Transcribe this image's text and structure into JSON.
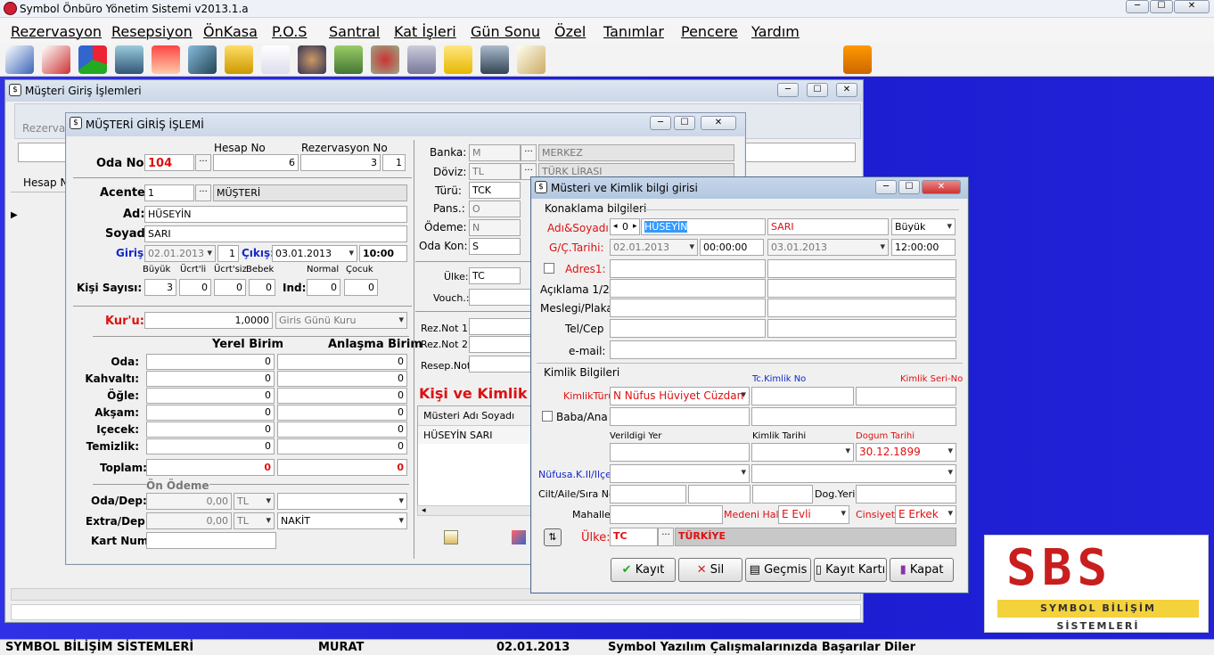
{
  "app": {
    "title": "Symbol Önbüro Yönetim Sistemi v2013.1.a",
    "min": "─",
    "max": "☐",
    "close": "✕"
  },
  "menu": [
    "Rezervasyon",
    "Resepsiyon",
    "ÖnKasa",
    "P.O.S",
    "Santral",
    "Kat İşleri",
    "Gün Sonu",
    "Özel",
    "Tanımlar",
    "Pencere",
    "Yardım"
  ],
  "toolbar_icons": [
    "edit-icon",
    "checklist-icon",
    "pie-chart-icon",
    "monitor-icon",
    "home-icon",
    "satellite-icon",
    "folder-icon",
    "document-icon",
    "user-search-icon",
    "money-icon",
    "disc-icon",
    "calculator-icon",
    "notes-icon",
    "presenter-icon",
    "notepad-icon",
    "exit-door-icon"
  ],
  "outer": {
    "title": "Müşteri Giriş İşlemleri",
    "rezervasyon": "Rezervas",
    "hesap": "Hesap N"
  },
  "mgi": {
    "title": "MÜŞTERİ GİRİŞ İŞLEMİ",
    "hesap_no_label": "Hesap No",
    "rez_no_label": "Rezervasyon No",
    "oda_no_label": "Oda No:",
    "oda_no": "104",
    "hesap_no": "6",
    "rez_no": "3",
    "rez_seq": "1",
    "acente_label": "Acente:",
    "acente": "1",
    "acente_name": "MÜŞTERİ",
    "ad_label": "Ad:",
    "ad": "HÜSEYİN",
    "soyad_label": "Soyad:",
    "soyad": "SARI",
    "giris_label": "Giriş:",
    "giris": "02.01.2013",
    "gece": "1",
    "cikis_label": "Çıkış:",
    "cikis": "03.01.2013",
    "saat": "10:00",
    "buyuk": "Büyük",
    "ucretli": "Ücrt'li",
    "ucretsiz": "Ücrt'siz",
    "bebek": "Bebek",
    "normal": "Normal",
    "cocuk": "Çocuk",
    "kisi_label": "Kişi Sayısı:",
    "k1": "3",
    "k2": "0",
    "k3": "0",
    "k4": "0",
    "ind_label": "Ind:",
    "k5": "0",
    "k6": "0",
    "kur_label": "Kur'u:",
    "kur": "1,0000",
    "kur_tipi": "Giris Günü Kuru",
    "yerel": "Yerel Birim",
    "anlasma": "Anlaşma Birim",
    "meals": [
      {
        "label": "Oda:",
        "y": "0",
        "a": "0"
      },
      {
        "label": "Kahvaltı:",
        "y": "0",
        "a": "0"
      },
      {
        "label": "Öğle:",
        "y": "0",
        "a": "0"
      },
      {
        "label": "Akşam:",
        "y": "0",
        "a": "0"
      },
      {
        "label": "Içecek:",
        "y": "0",
        "a": "0"
      },
      {
        "label": "Temizlik:",
        "y": "0",
        "a": "0"
      }
    ],
    "toplam_label": "Toplam:",
    "toplam_y": "0",
    "toplam_a": "0",
    "on_odeme": "Ön Ödeme",
    "oda_dep_label": "Oda/Dep:",
    "oda_dep": "0,00",
    "oda_dep_cur": "TL",
    "extra_dep_label": "Extra/Dep:",
    "extra_dep": "0,00",
    "extra_dep_cur": "TL",
    "odeme_tipi": "NAKİT",
    "kart_label": "Kart Num:",
    "banka_label": "Banka:",
    "banka": "M",
    "banka_name": "MERKEZ",
    "doviz_label": "Döviz:",
    "doviz": "TL",
    "doviz_name": "TÜRK LİRASI",
    "turu_label": "Türü:",
    "turu": "TCK",
    "pans_label": "Pans.:",
    "pans": "O",
    "odeme_label": "Ödeme:",
    "odeme": "N",
    "odakon_label": "Oda Kon:",
    "odakon": "S",
    "ulke_label": "Ülke:",
    "ulke": "TC",
    "vouch_label": "Vouch.:",
    "reznot1": "Rez.Not 1:",
    "reznot2": "Rez.Not 2:",
    "resepnot": "Resep.Not:",
    "kisi_kimlik": "Kişi ve Kimlik Bi",
    "col_header": "Müsteri Adı Soyadı",
    "guest_row": "HÜSEYİN SARI"
  },
  "mk": {
    "title": "Müsteri ve Kimlik bilgi girisi",
    "konaklama": "Konaklama bilgileri",
    "adsoyad_label": "Adı&Soyadı",
    "seq": "0",
    "ad": "HÜSEYİN",
    "soyad": "SARI",
    "tip": "Büyük",
    "gc_label": "G/Ç.Tarihi:",
    "giris": "02.01.2013",
    "giris_saat": "00:00:00",
    "cikis": "03.01.2013",
    "cikis_saat": "12:00:00",
    "adres_label": "Adres1:",
    "aciklama_label": "Açıklama 1/2:",
    "meslek_label": "Meslegi/Plaka",
    "tel_label": "Tel/Cep",
    "email_label": "e-mail:",
    "kimlik_bilgileri": "Kimlik Bilgileri",
    "tc_label": "Tc.Kimlik No",
    "seri_label": "Kimlik Seri-No",
    "kimlik_turu_label": "KimlikTürü:",
    "kimlik_turu": "N Nüfus Hüviyet Cüzdan",
    "baba_label": "Baba/Ana",
    "verildigi_label": "Verildigi Yer",
    "kimlik_tarihi_label": "Kimlik Tarihi",
    "dogum_label": "Dogum Tarihi",
    "dogum": "30.12.1899",
    "nufus_label": "Nüfusa.K.Il/Ilçe:",
    "cilt_label": "Cilt/Aile/Sıra No:",
    "dogyeri_label": "Dog.Yeri",
    "mahalle_label": "Mahalle:",
    "medeni_label": "Medeni Hali",
    "medeni": "E Evli",
    "cinsiyet_label": "Cinsiyeti",
    "cinsiyet": "E Erkek",
    "ulke_label": "Ülke:",
    "ulke": "TC",
    "ulke_name": "TÜRKİYE",
    "kayit": "Kayıt",
    "sil": "Sil",
    "gecmis": "Geçmis",
    "kayit_karti": "Kayıt Kartı",
    "kapat": "Kapat"
  },
  "logo": {
    "big": "SBS",
    "small": "SYMBOL BİLİŞİM SİSTEMLERİ"
  },
  "status": {
    "company": "SYMBOL BİLİŞİM SİSTEMLERİ",
    "user": "MURAT",
    "date": "02.01.2013",
    "message": "Symbol Yazılım Çalışmalarınızda Başarılar Diler"
  }
}
